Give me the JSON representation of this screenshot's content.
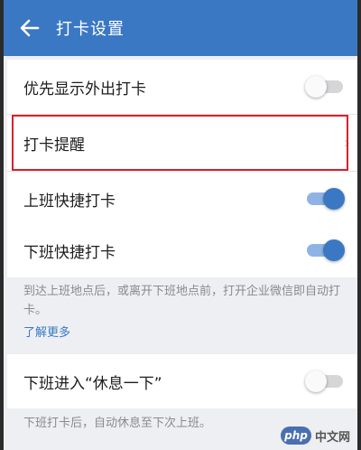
{
  "header": {
    "title": "打卡设置",
    "back_icon": "arrow-left-icon"
  },
  "rows": {
    "show_outgoing": {
      "label": "优先显示外出打卡",
      "toggle": "off"
    },
    "reminder": {
      "label": "打卡提醒",
      "chevron_icon": "chevron-right-icon"
    },
    "quick_in": {
      "label": "上班快捷打卡",
      "toggle": "on"
    },
    "quick_out": {
      "label": "下班快捷打卡",
      "toggle": "on"
    },
    "rest_mode": {
      "label": "下班进入“休息一下”",
      "toggle": "off"
    }
  },
  "notes": {
    "quick_desc": "到达上班地点后，或离开下班地点前，打开企业微信即自动打卡。",
    "learn_more": "了解更多",
    "rest_desc": "下班打卡后，自动休息至下次上班。"
  },
  "watermark": {
    "badge": "php",
    "text": "中文网"
  },
  "colors": {
    "accent": "#3a78c4",
    "highlight": "#d8202a"
  }
}
